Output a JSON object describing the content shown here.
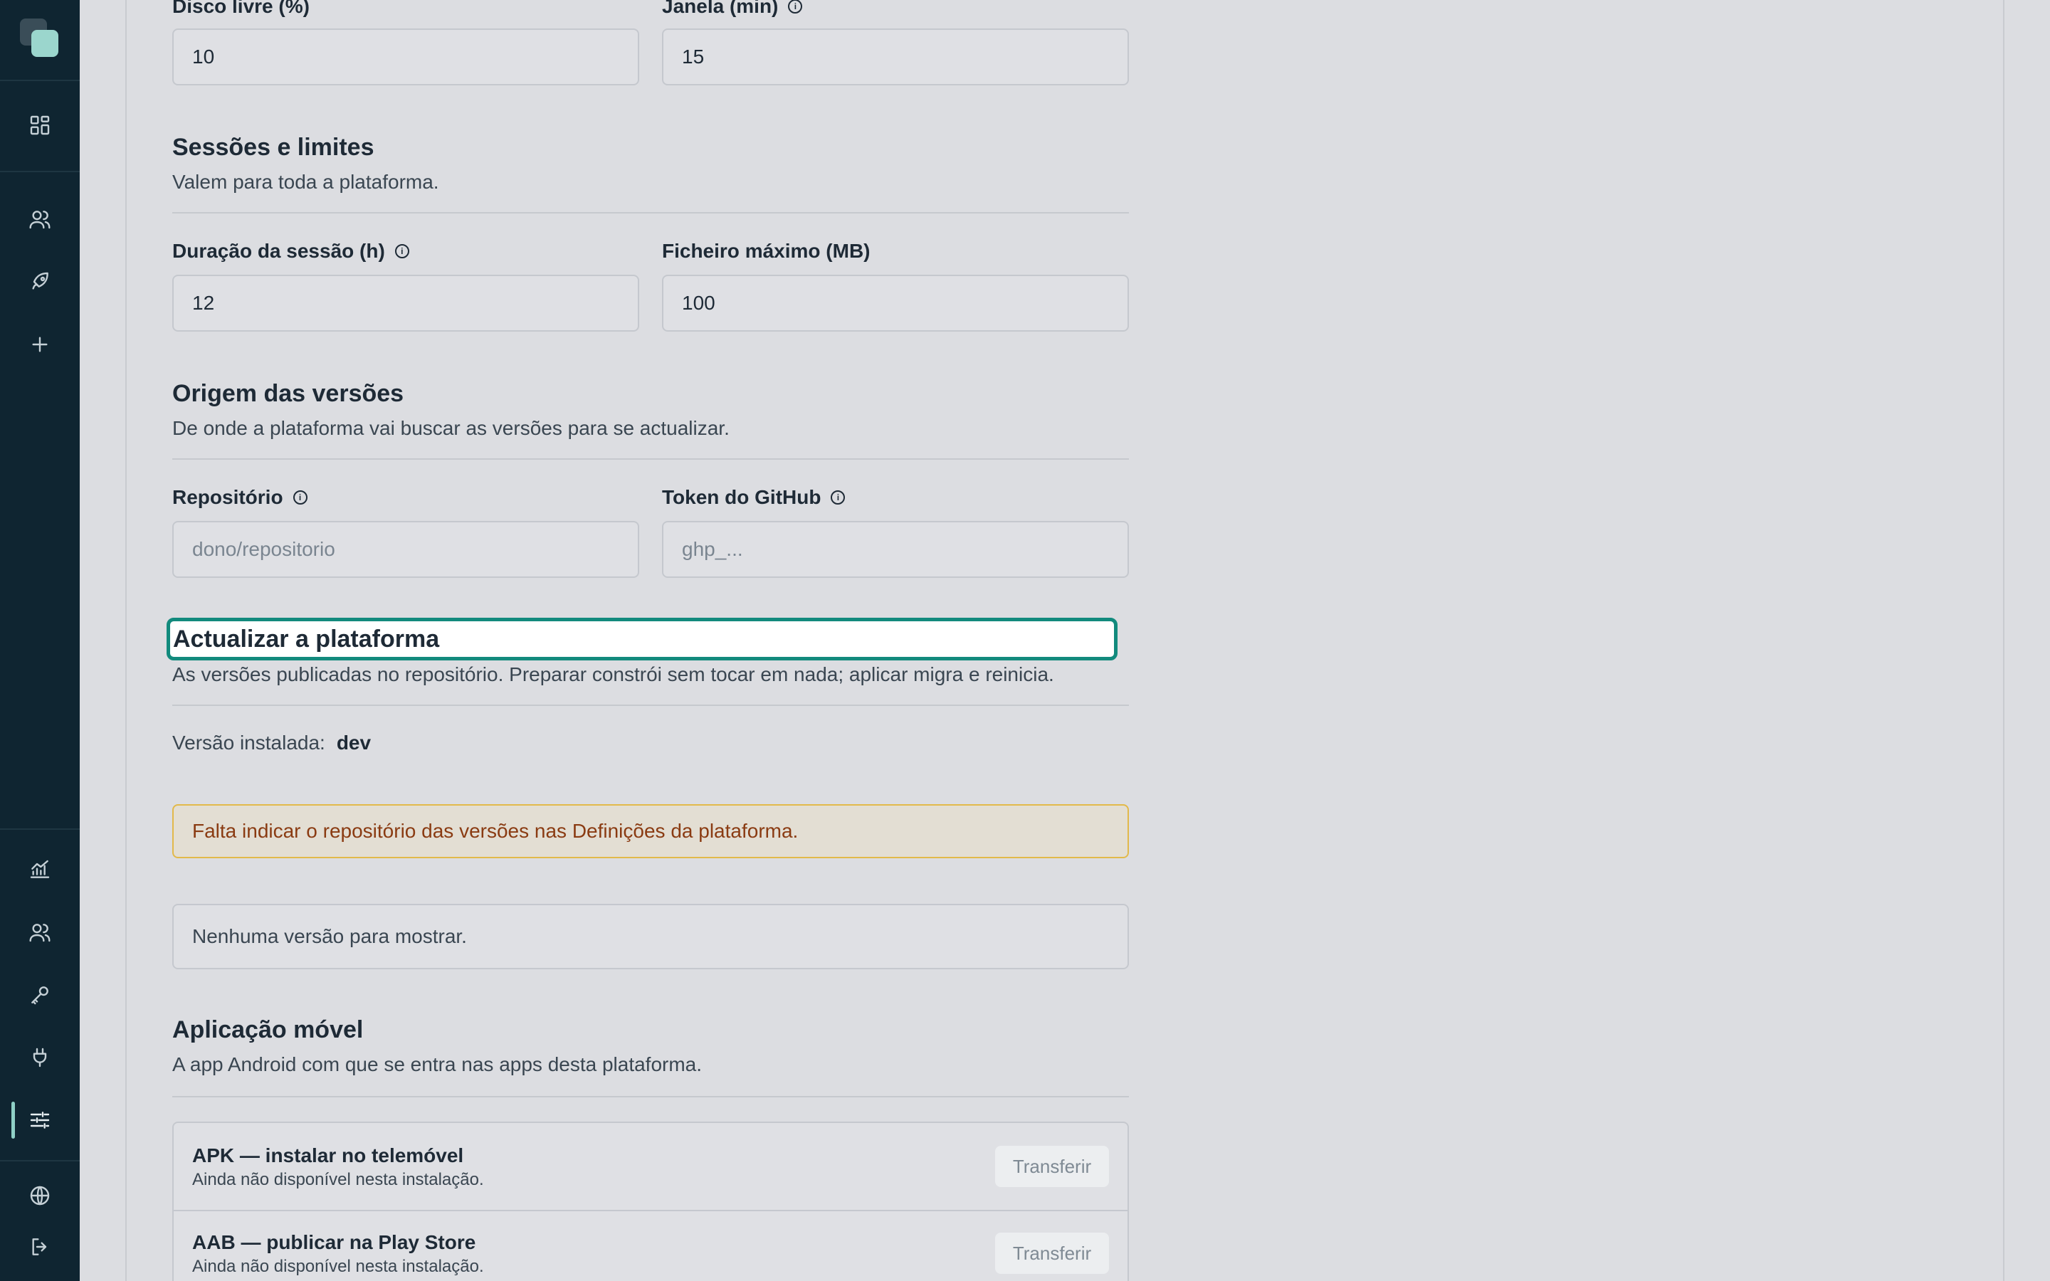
{
  "fields_top": {
    "disk_label": "Disco livre (%)",
    "disk_value": "10",
    "window_label": "Janela (min)",
    "window_value": "15"
  },
  "sessions": {
    "title": "Sessões e limites",
    "subtitle": "Valem para toda a plataforma.",
    "duration_label": "Duração da sessão (h)",
    "duration_value": "12",
    "max_file_label": "Ficheiro máximo (MB)",
    "max_file_value": "100"
  },
  "versions_source": {
    "title": "Origem das versões",
    "subtitle": "De onde a plataforma vai buscar as versões para se actualizar.",
    "repo_label": "Repositório",
    "repo_placeholder": "dono/repositorio",
    "token_label": "Token do GitHub",
    "token_placeholder": "ghp_..."
  },
  "update": {
    "title": "Actualizar a plataforma",
    "subtitle": "As versões publicadas no repositório. Preparar constrói sem tocar em nada; aplicar migra e reinicia.",
    "installed_label": "Versão instalada:",
    "installed_value": "dev",
    "warning": "Falta indicar o repositório das versões nas Definições da plataforma.",
    "empty": "Nenhuma versão para mostrar."
  },
  "mobile": {
    "title": "Aplicação móvel",
    "subtitle": "A app Android com que se entra nas apps desta plataforma.",
    "items": [
      {
        "title": "APK — instalar no telemóvel",
        "subtitle": "Ainda não disponível nesta instalação.",
        "button": "Transferir"
      },
      {
        "title": "AAB — publicar na Play Store",
        "subtitle": "Ainda não disponível nesta instalação.",
        "button": "Transferir"
      }
    ]
  },
  "icons": {
    "info": "i",
    "nav": [
      "dashboard-icon",
      "users-icon",
      "rocket-icon",
      "plus-icon",
      "chart-icon",
      "team-icon",
      "key-icon",
      "plug-icon",
      "sliders-icon",
      "globe-icon",
      "logout-icon"
    ]
  },
  "colors": {
    "sidebar": "#0f2531",
    "accent": "#128a7d",
    "warning_border": "#e2b94a",
    "warning_text": "#8a3b12"
  }
}
